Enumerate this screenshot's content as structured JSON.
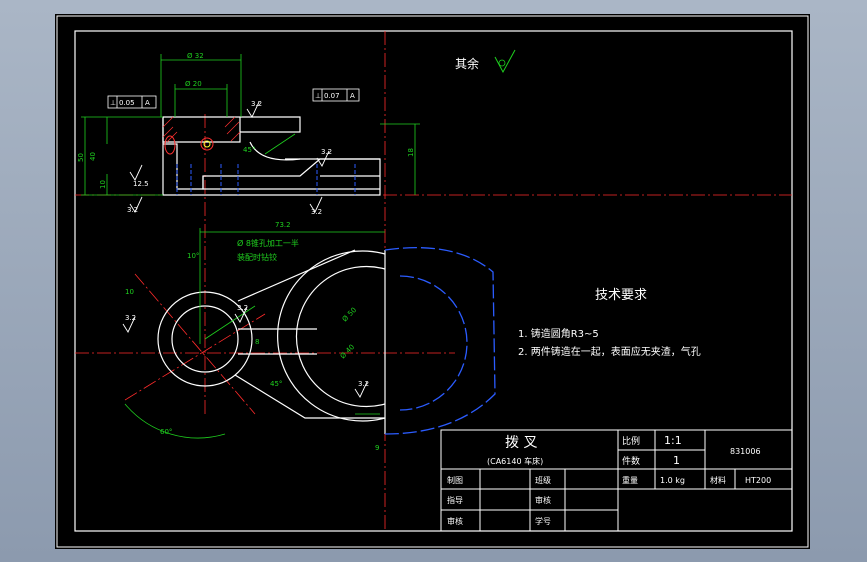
{
  "colors": {
    "background": "#000000",
    "frame": "#ffffff",
    "outline": "#ffffff",
    "dimension": "#1fd11f",
    "centerline": "#ff2b2b",
    "hidden": "#2b5cff",
    "hatch": "#ff3030",
    "highlight": "#ffff33"
  },
  "roughness_note": {
    "label": "其余"
  },
  "tech_req": {
    "title": "技术要求",
    "items": [
      "1. 铸造圆角R3~5",
      "2. 两件铸造在一起，表面应无夹渣，气孔"
    ]
  },
  "top_view": {
    "dims": {
      "d_outer": "Ø 32",
      "d_inner": "Ø 20",
      "h40": "40",
      "h50": "50",
      "h10": "10",
      "ra_a": "3.2",
      "ra_b": "3.2",
      "ra_c": "3.2",
      "ra_d": "3.2",
      "ra_e": "12.5",
      "h_right": "18",
      "deg": "45°"
    },
    "tol1": {
      "sym": "⊥",
      "val": "0.05",
      "datum": "A"
    },
    "tol2": {
      "sym": "⊥",
      "val": "0.07",
      "datum": "A"
    }
  },
  "front_view": {
    "dims": {
      "d73": "73.2",
      "note1": "Ø 8锥孔加工一半",
      "note2": "装配时钻铰",
      "ang10": "10°",
      "len10": "10",
      "ra_f": "3.2",
      "ra_g": "3.2",
      "dia_a": "Ø 50",
      "dia_b": "Ø 40",
      "len8": "8",
      "ang60": "60°",
      "ang45": "45°",
      "ra_h": "3.2",
      "dim9": "9"
    }
  },
  "title_block": {
    "part_name": "拨  叉",
    "model": "(CA6140 车床)",
    "scale_label": "比例",
    "scale_value": "1:1",
    "qty_label": "件数",
    "qty_value": "1",
    "code": "831006",
    "drawn_label": "制图",
    "school_label": "班级",
    "design_label": "指导",
    "review_label": "审核",
    "checker_label": "审核",
    "seq_label": "学号",
    "weight_label": "重量",
    "weight_value": "1.0 kg",
    "material_label": "材料",
    "material_value": "HT200"
  }
}
